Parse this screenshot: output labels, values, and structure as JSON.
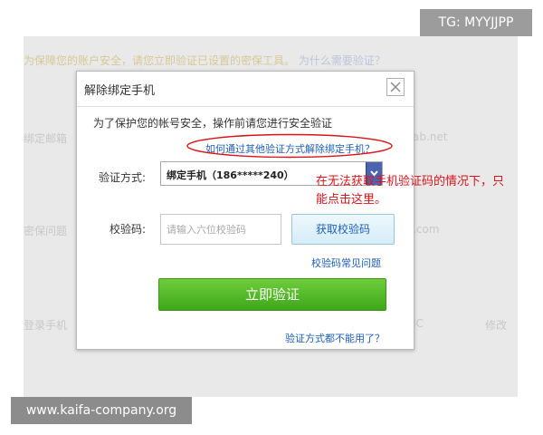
{
  "background": {
    "top_text": "为保障您的账户安全，请您立即验证已设置的密保工具。",
    "top_link": "为什么需要验证？",
    "row1": "绑定邮箱",
    "row2": "密保问题",
    "row3": "登录手机",
    "right1": "ab.net",
    "right2": ".com",
    "right3": "IC",
    "right3b": "修改"
  },
  "watermark": {
    "tag": "TG: MYYJJPP",
    "site": "www.kaifa-company.org"
  },
  "dialog": {
    "title": "解除绑定手机",
    "intro": "为了保护您的帐号安全，操作前请您进行安全验证",
    "alt_link": "如何通过其他验证方式解除绑定手机？",
    "method_label": "验证方式:",
    "method_value": "绑定手机（186*****240）",
    "code_label": "校验码:",
    "code_value": "",
    "code_placeholder": "请输入六位校验码",
    "get_code_label": "获取校验码",
    "faq_link": "校验码常见问题",
    "verify_label": "立即验证",
    "unavailable_link": "验证方式都不能用了？"
  },
  "annotation": {
    "note": "在无法获取手机验证码的情况下，只能点击这里。",
    "color": "#d9141a"
  },
  "colors": {
    "link": "#1f5fb8",
    "verify_button": "#4cb624",
    "dim_background": "#e9e9e9"
  },
  "icons": {
    "close": "close-icon",
    "dropdown": "chevron-down-icon"
  }
}
